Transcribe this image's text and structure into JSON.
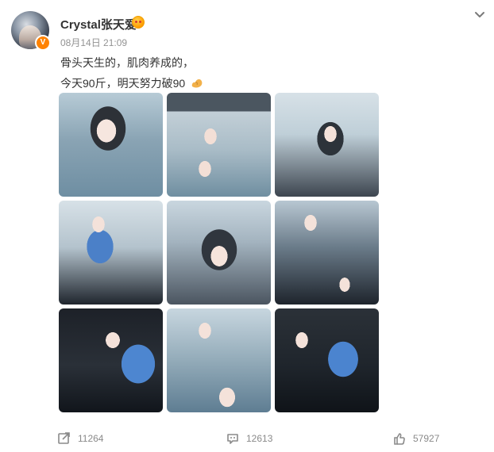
{
  "post": {
    "author": "Crystal张天爱",
    "timestamp": "08月14日 21:09",
    "text_lines": [
      "骨头天生的，肌肉养成的，",
      "今天90斤，明天努力破90"
    ]
  },
  "footer": {
    "shares": "11264",
    "comments": "12613",
    "likes": "57927"
  },
  "colors": {
    "verified": "#ff8200"
  },
  "icons": {
    "verified": "verified-badge",
    "vip": "vip-emoji-icon",
    "menu": "chevron-down-icon",
    "share": "share-icon",
    "comment": "comment-icon",
    "like": "like-icon",
    "muscle": "flexed-biceps-emoji-icon"
  }
}
